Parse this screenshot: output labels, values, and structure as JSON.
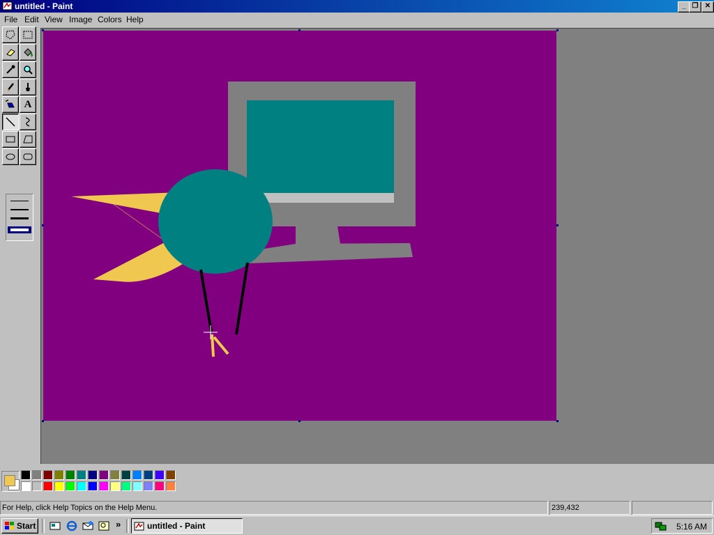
{
  "window": {
    "title": "untitled - Paint"
  },
  "caption_buttons": {
    "minimize": "_",
    "maximize": "❐",
    "close": "✕"
  },
  "menu": [
    "File",
    "Edit",
    "View",
    "Image",
    "Colors",
    "Help"
  ],
  "tools": [
    {
      "name": "free-form-select-icon"
    },
    {
      "name": "select-icon"
    },
    {
      "name": "eraser-icon"
    },
    {
      "name": "fill-with-color-icon"
    },
    {
      "name": "pick-color-icon"
    },
    {
      "name": "magnifier-icon"
    },
    {
      "name": "pencil-icon"
    },
    {
      "name": "brush-icon"
    },
    {
      "name": "airbrush-icon"
    },
    {
      "name": "text-icon",
      "glyph": "A"
    },
    {
      "name": "line-icon",
      "selected": true
    },
    {
      "name": "curve-icon"
    },
    {
      "name": "rectangle-icon"
    },
    {
      "name": "polygon-icon"
    },
    {
      "name": "ellipse-icon"
    },
    {
      "name": "rounded-rectangle-icon"
    }
  ],
  "current_colors": {
    "foreground": "#f0c850",
    "background": "#ffffff"
  },
  "palette": {
    "row1": [
      "#000000",
      "#808080",
      "#800000",
      "#808000",
      "#008000",
      "#008080",
      "#000080",
      "#800080",
      "#808040",
      "#004040",
      "#0080ff",
      "#004080",
      "#4000ff",
      "#804000"
    ],
    "row2": [
      "#ffffff",
      "#c0c0c0",
      "#ff0000",
      "#ffff00",
      "#00ff00",
      "#00ffff",
      "#0000ff",
      "#ff00ff",
      "#ffff80",
      "#00ff80",
      "#80ffff",
      "#8080ff",
      "#ff0080",
      "#ff8040"
    ]
  },
  "canvas": {
    "background": "#800080",
    "accent_colors": {
      "monitor_frame": "#808080",
      "screen": "#008080",
      "bird": "#f0c850"
    }
  },
  "status": {
    "help_text": "For Help, click Help Topics on the Help Menu.",
    "coordinates": "239,432",
    "size": ""
  },
  "taskbar": {
    "start_label": "Start",
    "overflow": "»",
    "task_label": "untitled - Paint",
    "clock": "5:16 AM"
  }
}
